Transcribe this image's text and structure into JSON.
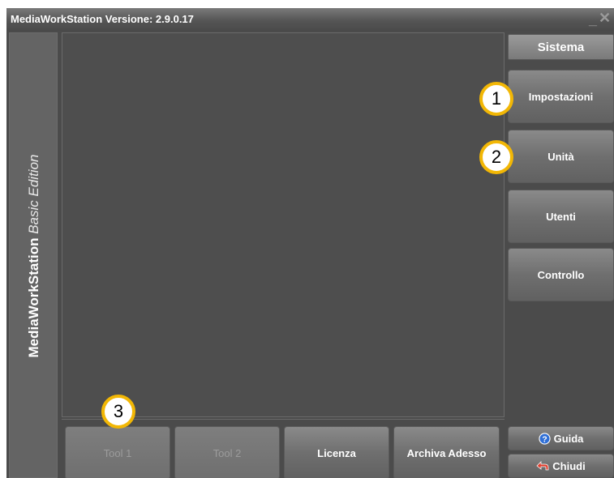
{
  "window": {
    "title": "MediaWorkStation Versione: 2.9.0.17",
    "minimize_glyph": "_",
    "close_glyph": "✕"
  },
  "side_band": {
    "brand": "MediaWorkStation",
    "edition": "Basic Edition"
  },
  "sidebar": {
    "header": "Sistema",
    "items": [
      {
        "label": "Impostazioni"
      },
      {
        "label": "Unità"
      },
      {
        "label": "Utenti"
      },
      {
        "label": "Controllo"
      }
    ]
  },
  "bottom_buttons": [
    {
      "label": "Tool 1",
      "enabled": false
    },
    {
      "label": "Tool 2",
      "enabled": false
    },
    {
      "label": "Licenza",
      "enabled": true
    },
    {
      "label": "Archiva Adesso",
      "enabled": true
    }
  ],
  "footer_buttons": {
    "help": {
      "label": "Guida",
      "icon": "help-circle-icon"
    },
    "close": {
      "label": "Chiudi",
      "icon": "exit-arrow-icon"
    }
  },
  "badges": [
    "1",
    "2",
    "3"
  ],
  "colors": {
    "badge_border": "#f2b705",
    "background": "#4b4b4b",
    "help_icon": "#2f6fd6",
    "exit_icon": "#e04030"
  }
}
